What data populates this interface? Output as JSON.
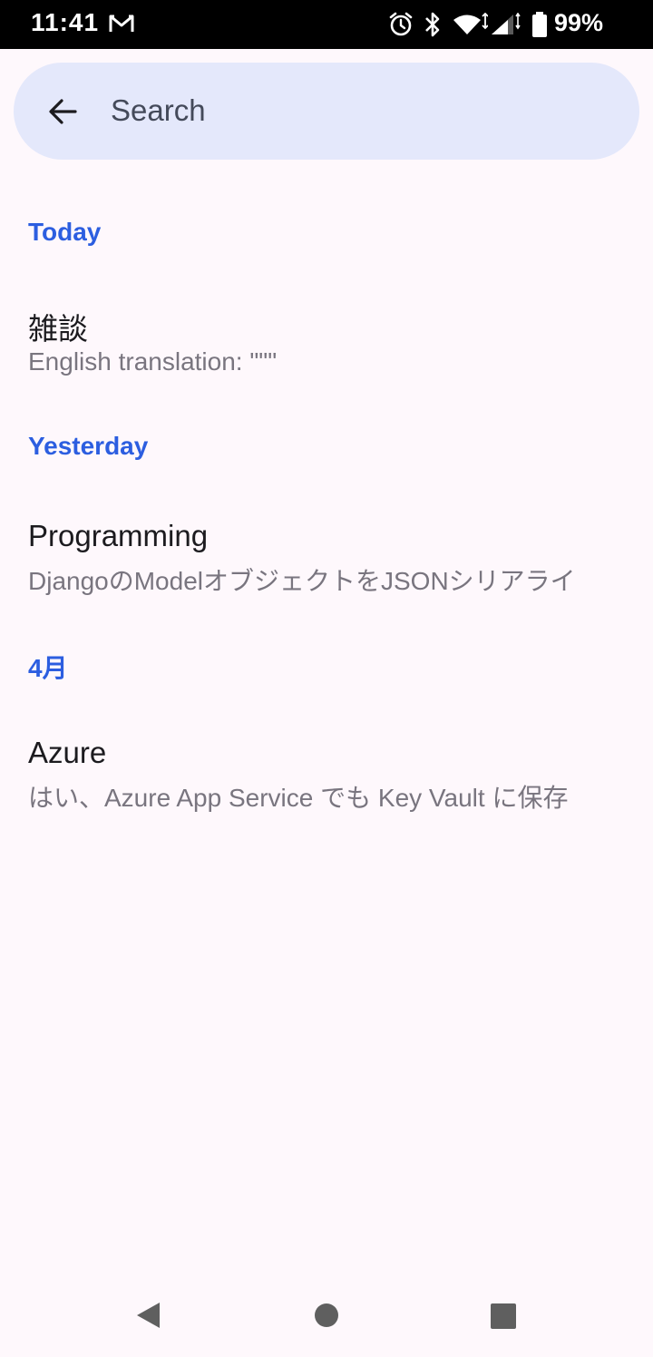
{
  "status_bar": {
    "time": "11:41",
    "battery": "99%",
    "icons": [
      "gmail-icon",
      "alarm-icon",
      "bluetooth-icon",
      "wifi-icon",
      "signal-icon",
      "battery-icon"
    ]
  },
  "search": {
    "placeholder": "Search",
    "back_icon": "arrow-back-icon"
  },
  "sections": [
    {
      "header": "Today",
      "items": [
        {
          "title": "雑談",
          "preview": "English translation: \"\"\""
        }
      ]
    },
    {
      "header": "Yesterday",
      "items": [
        {
          "title": "Programming",
          "preview": "DjangoのModelオブジェクトをJSONシリアライ"
        }
      ]
    },
    {
      "header": "4月",
      "items": [
        {
          "title": "Azure",
          "preview": "はい、Azure App Service でも Key Vault に保存"
        }
      ]
    }
  ],
  "nav": {
    "icons": [
      "nav-back-icon",
      "nav-home-icon",
      "nav-recents-icon"
    ]
  },
  "colors": {
    "background": "#fef8fc",
    "search_bar": "#e4e8fb",
    "section_header": "#2c5ee0",
    "title": "#1c1b1f",
    "preview": "#79757f"
  }
}
